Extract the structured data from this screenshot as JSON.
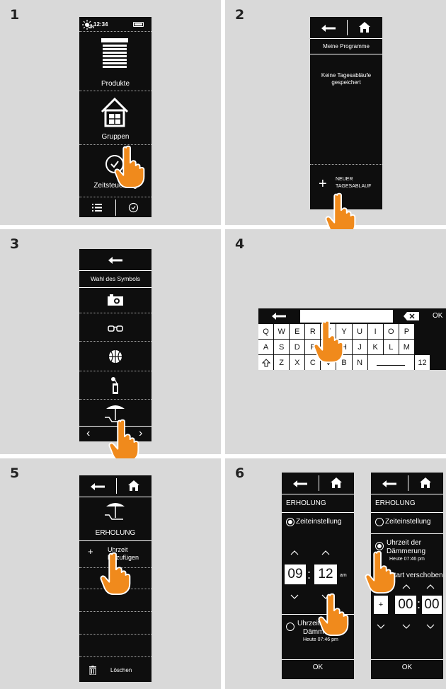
{
  "steps": [
    "1",
    "2",
    "3",
    "4",
    "5",
    "6"
  ],
  "panel1": {
    "status_time": "12:34",
    "status_on": "ON",
    "menu": [
      "Produkte",
      "Gruppen",
      "Zeitsteuerung"
    ],
    "bottom_tabs": [
      "list-icon",
      "clock-icon"
    ]
  },
  "panel2": {
    "title": "Meine Programme",
    "empty_line1": "Keine Tagesabläufe",
    "empty_line2": "gespeichert",
    "new_line1": "NEUER",
    "new_line2": "TAGESABLAUF"
  },
  "panel3": {
    "title": "Wahl des Symbols",
    "icons": [
      "camera-icon",
      "glasses-icon",
      "basketball-icon",
      "cocktail-icon",
      "beach-umbrella-icon"
    ]
  },
  "panel4": {
    "ok": "OK",
    "row1": [
      "Q",
      "W",
      "E",
      "R",
      "T",
      "Y",
      "U",
      "I",
      "O",
      "P"
    ],
    "row2": [
      "A",
      "S",
      "D",
      "F",
      "G",
      "H",
      "J",
      "K",
      "L",
      "M"
    ],
    "row3": [
      "Z",
      "X",
      "C",
      "V",
      "B",
      "N"
    ],
    "row3_end": "12"
  },
  "panel5": {
    "name": "ERHOLUNG",
    "add_line1": "Uhrzeit",
    "add_line2": "hinzufügen",
    "delete": "Löschen"
  },
  "panel6": {
    "left": {
      "name": "ERHOLUNG",
      "opt1": "Zeiteinstellung",
      "hour": "09",
      "minute": "12",
      "ampm": "am",
      "opt2_line1": "Uhrzeit der",
      "opt2_line2": "Dämmerung",
      "opt2_line3": "Heute 07:46 pm",
      "ok": "OK"
    },
    "right": {
      "name": "ERHOLUNG",
      "opt1": "Zeiteinstellung",
      "opt2_line1": "Uhrzeit der",
      "opt2_line2": "Dämmerung",
      "opt2_line3": "Heute 07:46 pm",
      "shift_label": "Start verschoben:",
      "sign": "+",
      "hour": "00",
      "minute": "00",
      "ok": "OK"
    }
  },
  "colors": {
    "panel": "#d9d9d9",
    "device": "#0e0e0e",
    "hand": "#f08a1c"
  }
}
